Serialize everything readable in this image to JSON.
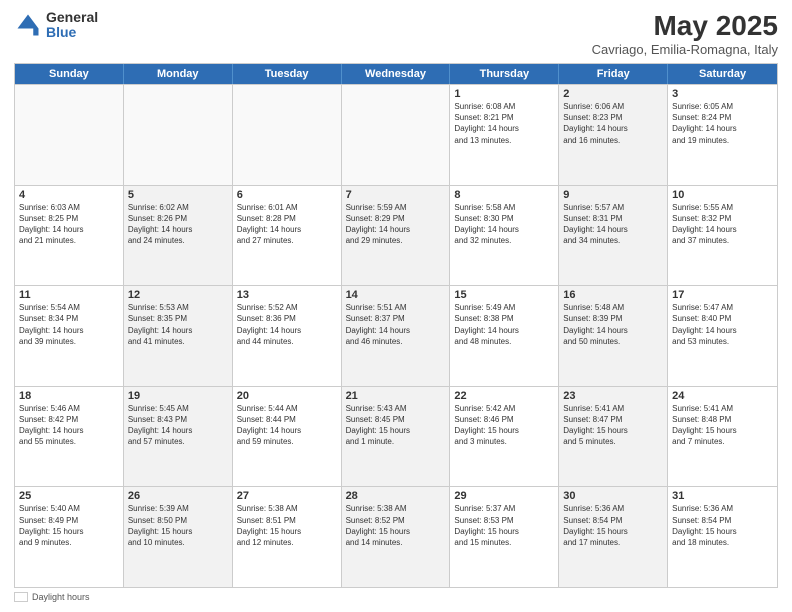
{
  "logo": {
    "general": "General",
    "blue": "Blue"
  },
  "title": "May 2025",
  "subtitle": "Cavriago, Emilia-Romagna, Italy",
  "days": [
    "Sunday",
    "Monday",
    "Tuesday",
    "Wednesday",
    "Thursday",
    "Friday",
    "Saturday"
  ],
  "weeks": [
    [
      {
        "num": "",
        "detail": "",
        "empty": true
      },
      {
        "num": "",
        "detail": "",
        "empty": true
      },
      {
        "num": "",
        "detail": "",
        "empty": true
      },
      {
        "num": "",
        "detail": "",
        "empty": true
      },
      {
        "num": "1",
        "detail": "Sunrise: 6:08 AM\nSunset: 8:21 PM\nDaylight: 14 hours\nand 13 minutes.",
        "shaded": false
      },
      {
        "num": "2",
        "detail": "Sunrise: 6:06 AM\nSunset: 8:23 PM\nDaylight: 14 hours\nand 16 minutes.",
        "shaded": true
      },
      {
        "num": "3",
        "detail": "Sunrise: 6:05 AM\nSunset: 8:24 PM\nDaylight: 14 hours\nand 19 minutes.",
        "shaded": false
      }
    ],
    [
      {
        "num": "4",
        "detail": "Sunrise: 6:03 AM\nSunset: 8:25 PM\nDaylight: 14 hours\nand 21 minutes.",
        "shaded": false
      },
      {
        "num": "5",
        "detail": "Sunrise: 6:02 AM\nSunset: 8:26 PM\nDaylight: 14 hours\nand 24 minutes.",
        "shaded": true
      },
      {
        "num": "6",
        "detail": "Sunrise: 6:01 AM\nSunset: 8:28 PM\nDaylight: 14 hours\nand 27 minutes.",
        "shaded": false
      },
      {
        "num": "7",
        "detail": "Sunrise: 5:59 AM\nSunset: 8:29 PM\nDaylight: 14 hours\nand 29 minutes.",
        "shaded": true
      },
      {
        "num": "8",
        "detail": "Sunrise: 5:58 AM\nSunset: 8:30 PM\nDaylight: 14 hours\nand 32 minutes.",
        "shaded": false
      },
      {
        "num": "9",
        "detail": "Sunrise: 5:57 AM\nSunset: 8:31 PM\nDaylight: 14 hours\nand 34 minutes.",
        "shaded": true
      },
      {
        "num": "10",
        "detail": "Sunrise: 5:55 AM\nSunset: 8:32 PM\nDaylight: 14 hours\nand 37 minutes.",
        "shaded": false
      }
    ],
    [
      {
        "num": "11",
        "detail": "Sunrise: 5:54 AM\nSunset: 8:34 PM\nDaylight: 14 hours\nand 39 minutes.",
        "shaded": false
      },
      {
        "num": "12",
        "detail": "Sunrise: 5:53 AM\nSunset: 8:35 PM\nDaylight: 14 hours\nand 41 minutes.",
        "shaded": true
      },
      {
        "num": "13",
        "detail": "Sunrise: 5:52 AM\nSunset: 8:36 PM\nDaylight: 14 hours\nand 44 minutes.",
        "shaded": false
      },
      {
        "num": "14",
        "detail": "Sunrise: 5:51 AM\nSunset: 8:37 PM\nDaylight: 14 hours\nand 46 minutes.",
        "shaded": true
      },
      {
        "num": "15",
        "detail": "Sunrise: 5:49 AM\nSunset: 8:38 PM\nDaylight: 14 hours\nand 48 minutes.",
        "shaded": false
      },
      {
        "num": "16",
        "detail": "Sunrise: 5:48 AM\nSunset: 8:39 PM\nDaylight: 14 hours\nand 50 minutes.",
        "shaded": true
      },
      {
        "num": "17",
        "detail": "Sunrise: 5:47 AM\nSunset: 8:40 PM\nDaylight: 14 hours\nand 53 minutes.",
        "shaded": false
      }
    ],
    [
      {
        "num": "18",
        "detail": "Sunrise: 5:46 AM\nSunset: 8:42 PM\nDaylight: 14 hours\nand 55 minutes.",
        "shaded": false
      },
      {
        "num": "19",
        "detail": "Sunrise: 5:45 AM\nSunset: 8:43 PM\nDaylight: 14 hours\nand 57 minutes.",
        "shaded": true
      },
      {
        "num": "20",
        "detail": "Sunrise: 5:44 AM\nSunset: 8:44 PM\nDaylight: 14 hours\nand 59 minutes.",
        "shaded": false
      },
      {
        "num": "21",
        "detail": "Sunrise: 5:43 AM\nSunset: 8:45 PM\nDaylight: 15 hours\nand 1 minute.",
        "shaded": true
      },
      {
        "num": "22",
        "detail": "Sunrise: 5:42 AM\nSunset: 8:46 PM\nDaylight: 15 hours\nand 3 minutes.",
        "shaded": false
      },
      {
        "num": "23",
        "detail": "Sunrise: 5:41 AM\nSunset: 8:47 PM\nDaylight: 15 hours\nand 5 minutes.",
        "shaded": true
      },
      {
        "num": "24",
        "detail": "Sunrise: 5:41 AM\nSunset: 8:48 PM\nDaylight: 15 hours\nand 7 minutes.",
        "shaded": false
      }
    ],
    [
      {
        "num": "25",
        "detail": "Sunrise: 5:40 AM\nSunset: 8:49 PM\nDaylight: 15 hours\nand 9 minutes.",
        "shaded": false
      },
      {
        "num": "26",
        "detail": "Sunrise: 5:39 AM\nSunset: 8:50 PM\nDaylight: 15 hours\nand 10 minutes.",
        "shaded": true
      },
      {
        "num": "27",
        "detail": "Sunrise: 5:38 AM\nSunset: 8:51 PM\nDaylight: 15 hours\nand 12 minutes.",
        "shaded": false
      },
      {
        "num": "28",
        "detail": "Sunrise: 5:38 AM\nSunset: 8:52 PM\nDaylight: 15 hours\nand 14 minutes.",
        "shaded": true
      },
      {
        "num": "29",
        "detail": "Sunrise: 5:37 AM\nSunset: 8:53 PM\nDaylight: 15 hours\nand 15 minutes.",
        "shaded": false
      },
      {
        "num": "30",
        "detail": "Sunrise: 5:36 AM\nSunset: 8:54 PM\nDaylight: 15 hours\nand 17 minutes.",
        "shaded": true
      },
      {
        "num": "31",
        "detail": "Sunrise: 5:36 AM\nSunset: 8:54 PM\nDaylight: 15 hours\nand 18 minutes.",
        "shaded": false
      }
    ]
  ],
  "footer": {
    "daylight_label": "Daylight hours"
  }
}
